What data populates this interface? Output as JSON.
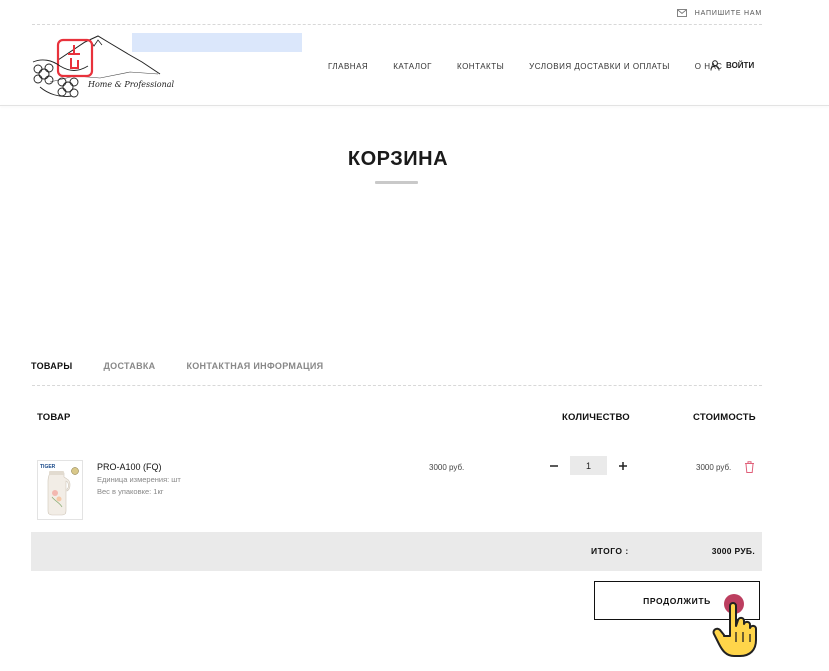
{
  "header": {
    "write_us": "НАПИШИТЕ НАМ",
    "logo_caption": "Home & Professional",
    "nav": [
      {
        "label": "ГЛАВНАЯ"
      },
      {
        "label": "КАТАЛОГ"
      },
      {
        "label": "КОНТАКТЫ"
      },
      {
        "label": "УСЛОВИЯ ДОСТАВКИ И ОПЛАТЫ"
      },
      {
        "label": "О НАС"
      }
    ],
    "login": "ВОЙТИ"
  },
  "page": {
    "title": "КОРЗИНА"
  },
  "tabs": [
    {
      "label": "ТОВАРЫ",
      "active": true
    },
    {
      "label": "ДОСТАВКА",
      "active": false
    },
    {
      "label": "КОНТАКТНАЯ ИНФОРМАЦИЯ",
      "active": false
    }
  ],
  "table": {
    "headers": {
      "product": "ТОВАР",
      "quantity": "КОЛИЧЕСТВО",
      "cost": "СТОИМОСТЬ"
    },
    "rows": [
      {
        "brand": "TIGER",
        "name": "PRO-A100 (FQ)",
        "unit": "Единица измерения: шт",
        "weight": "Вес в упаковке: 1кг",
        "price": "3000 руб.",
        "quantity": "1",
        "cost": "3000 руб."
      }
    ]
  },
  "total": {
    "label": "ИТОГО :",
    "value": "3000 РУБ."
  },
  "actions": {
    "continue": "ПРОДОЛЖИТЬ"
  },
  "colors": {
    "accent_red": "#e8323c",
    "trash_pink": "#e0607a",
    "cursor_yellow": "#ffd54a",
    "cursor_dot": "#b5294e"
  },
  "icons": [
    "envelope-icon",
    "user-icon",
    "minus-icon",
    "plus-icon",
    "trash-icon",
    "pointer-hand-icon"
  ]
}
